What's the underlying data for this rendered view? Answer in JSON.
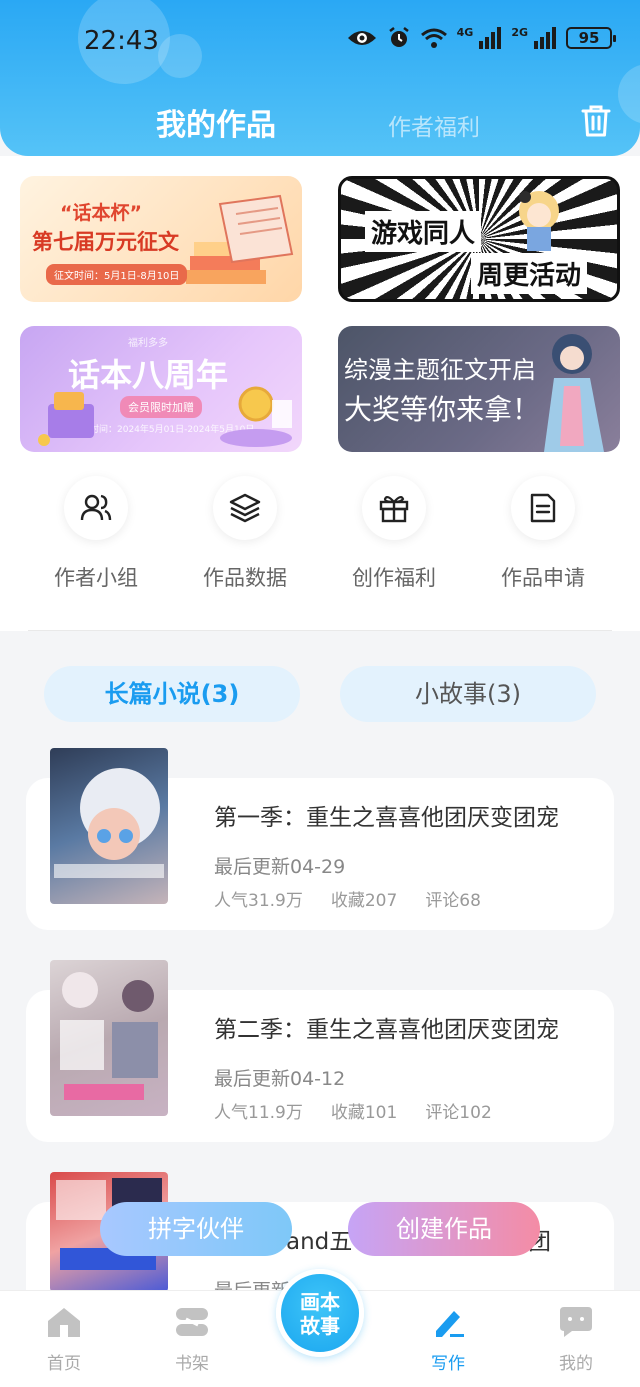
{
  "status": {
    "time": "22:43",
    "net4g": "4G",
    "net2g": "2G",
    "battery": "95"
  },
  "header": {
    "tab_active": "我的作品",
    "tab_inactive": "作者福利",
    "trash_icon": "trash-icon"
  },
  "banners": [
    {
      "line1": "“话本杯”",
      "line2": "第七届万元征文",
      "line3": "征文时间：5月1日-8月10日"
    },
    {
      "line1": "游戏同人",
      "line2": "周更活动"
    },
    {
      "line0": "福利多多",
      "line1": "话本八周年",
      "line2": "会员限时加赠",
      "line3": "时间：2024年5月01日-2024年5月10日"
    },
    {
      "line1": "综漫主题征文开启",
      "line2": "大奖等你来拿！"
    }
  ],
  "quick_actions": [
    {
      "label": "作者小组",
      "icon": "users-icon"
    },
    {
      "label": "作品数据",
      "icon": "layers-icon"
    },
    {
      "label": "创作福利",
      "icon": "gift-icon"
    },
    {
      "label": "作品申请",
      "icon": "document-icon"
    }
  ],
  "segments": {
    "long": "长篇小说(3)",
    "short": "小故事(3)"
  },
  "works": [
    {
      "title": "第一季：重生之喜喜他团厌变团宠",
      "updated": "最后更新04-29",
      "popularity": "人气31.9万",
      "favorites": "收藏207",
      "comments": "评论68"
    },
    {
      "title": "第二季：重生之喜喜他团厌变团宠",
      "updated": "最后更新04-12",
      "popularity": "人气11.9万",
      "favorites": "收藏101",
      "comments": "评论102"
    },
    {
      "title_visible": "and五",
      "title_end": "团",
      "updated": "最后更新"
    }
  ],
  "float_buttons": {
    "partner": "拼字伙伴",
    "create": "创建作品"
  },
  "nav": {
    "home": "首页",
    "shelf": "书架",
    "center_line1": "画本",
    "center_line2": "故事",
    "write": "写作",
    "mine": "我的"
  },
  "colors": {
    "accent": "#1a9cf0",
    "header": "#2aa8f4"
  }
}
